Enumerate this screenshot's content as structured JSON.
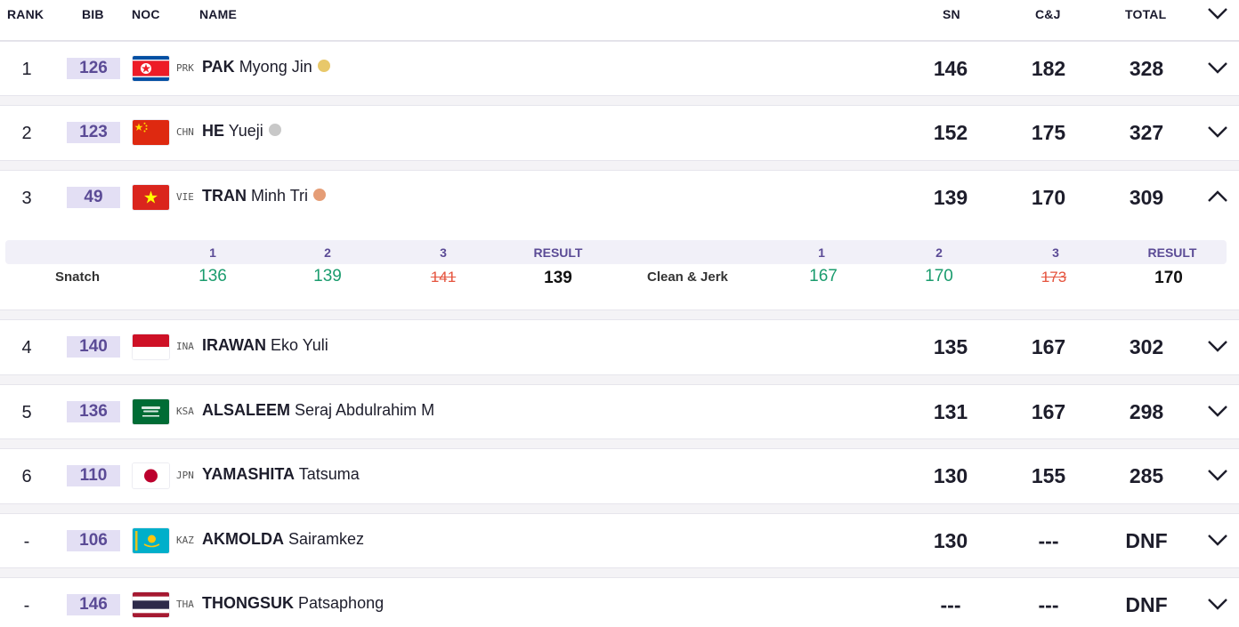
{
  "columns": {
    "rank": "RANK",
    "bib": "BIB",
    "noc": "NOC",
    "name": "NAME",
    "sn": "SN",
    "cj": "C&J",
    "total": "TOTAL"
  },
  "colors": {
    "bib_bg": "#e3dff4",
    "bib_text": "#5b4b96",
    "good_lift": "#1b9c6e",
    "failed_lift": "#e5533d",
    "gold": "#e8c86a",
    "silver": "#c8c8c8",
    "bronze": "#e59d76"
  },
  "athletes": [
    {
      "rank": "1",
      "bib": "126",
      "noc": "PRK",
      "surname": "PAK",
      "given": "Myong Jin",
      "medal": "gold",
      "sn": "146",
      "cj": "182",
      "total": "328",
      "flag": "prk-flag-icon"
    },
    {
      "rank": "2",
      "bib": "123",
      "noc": "CHN",
      "surname": "HE",
      "given": "Yueji",
      "medal": "silver",
      "sn": "152",
      "cj": "175",
      "total": "327",
      "flag": "chn-flag-icon"
    },
    {
      "rank": "3",
      "bib": "49",
      "noc": "VIE",
      "surname": "TRAN",
      "given": "Minh Tri",
      "medal": "bronze",
      "sn": "139",
      "cj": "170",
      "total": "309",
      "flag": "vie-flag-icon"
    },
    {
      "rank": "4",
      "bib": "140",
      "noc": "INA",
      "surname": "IRAWAN",
      "given": "Eko Yuli",
      "medal": "",
      "sn": "135",
      "cj": "167",
      "total": "302",
      "flag": "ina-flag-icon"
    },
    {
      "rank": "5",
      "bib": "136",
      "noc": "KSA",
      "surname": "ALSALEEM",
      "given": "Seraj Abdulrahim M",
      "medal": "",
      "sn": "131",
      "cj": "167",
      "total": "298",
      "flag": "ksa-flag-icon"
    },
    {
      "rank": "6",
      "bib": "110",
      "noc": "JPN",
      "surname": "YAMASHITA",
      "given": "Tatsuma",
      "medal": "",
      "sn": "130",
      "cj": "155",
      "total": "285",
      "flag": "jpn-flag-icon"
    },
    {
      "rank": "-",
      "bib": "106",
      "noc": "KAZ",
      "surname": "AKMOLDA",
      "given": "Sairamkez",
      "medal": "",
      "sn": "130",
      "cj": "---",
      "total": "DNF",
      "flag": "kaz-flag-icon"
    },
    {
      "rank": "-",
      "bib": "146",
      "noc": "THA",
      "surname": "THONGSUK",
      "given": "Patsaphong",
      "medal": "",
      "sn": "---",
      "cj": "---",
      "total": "DNF",
      "flag": "tha-flag-icon"
    }
  ],
  "expanded_detail": {
    "athlete_rank": "3",
    "attempt_headers": [
      "1",
      "2",
      "3"
    ],
    "result_header": "RESULT",
    "snatch": {
      "label": "Snatch",
      "attempts": [
        "136",
        "139",
        "141"
      ],
      "attempt_status": [
        "good",
        "good",
        "fail"
      ],
      "result": "139"
    },
    "clean_jerk": {
      "label": "Clean & Jerk",
      "attempts": [
        "167",
        "170",
        "173"
      ],
      "attempt_status": [
        "good",
        "good",
        "fail"
      ],
      "result": "170"
    }
  }
}
